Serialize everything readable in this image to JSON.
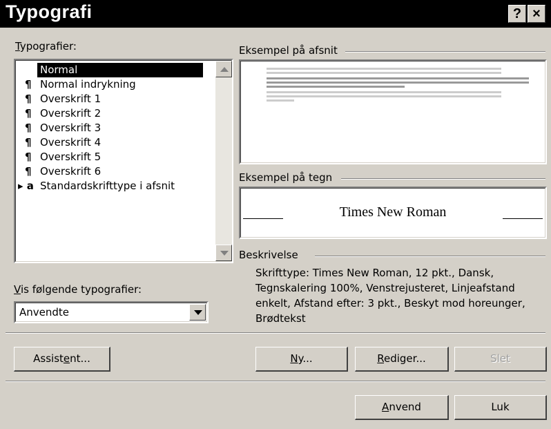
{
  "window": {
    "title": "Typografi",
    "help_button": "?",
    "close_button": "×"
  },
  "styles_list": {
    "label": "Typografier:",
    "label_accel": "T",
    "label_rest": "ypografier:",
    "items": [
      {
        "mark": "",
        "label": "Normal",
        "selected": true
      },
      {
        "mark": "¶",
        "label": "Normal indrykning"
      },
      {
        "mark": "¶",
        "label": "Overskrift 1"
      },
      {
        "mark": "¶",
        "label": "Overskrift 2"
      },
      {
        "mark": "¶",
        "label": "Overskrift 3"
      },
      {
        "mark": "¶",
        "label": "Overskrift 4"
      },
      {
        "mark": "¶",
        "label": "Overskrift 5"
      },
      {
        "mark": "¶",
        "label": "Overskrift 6"
      },
      {
        "mark": "▸ a",
        "label": "Standardskrifttype i afsnit"
      }
    ]
  },
  "show_styles": {
    "label_accel": "V",
    "label_rest": "is følgende typografier:",
    "value": "Anvendte"
  },
  "paragraph_preview": {
    "label": "Eksempel på afsnit"
  },
  "char_preview": {
    "label": "Eksempel på tegn",
    "sample": "Times New Roman"
  },
  "description": {
    "label": "Beskrivelse",
    "lines": [
      "Skrifttype: Times New Roman, 12 pkt., Dansk,",
      "Tegnskalering 100%, Venstrejusteret, Linjeafstand",
      "enkelt, Afstand  efter: 3 pkt., Beskyt mod horeunger,",
      "Brødtekst"
    ]
  },
  "buttons": {
    "assistant": {
      "pre": "Assist",
      "accel": "e",
      "post": "nt..."
    },
    "new": {
      "pre": "",
      "accel": "N",
      "post": "y..."
    },
    "edit": {
      "pre": "",
      "accel": "R",
      "post": "ediger..."
    },
    "delete": {
      "label": "Slet"
    },
    "apply": {
      "pre": "",
      "accel": "A",
      "post": "nvend"
    },
    "close": {
      "label": "Luk"
    }
  }
}
